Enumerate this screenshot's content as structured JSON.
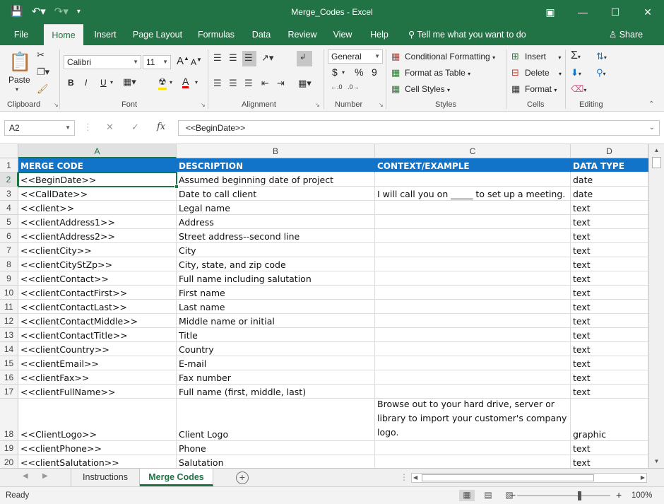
{
  "window": {
    "title": "Merge_Codes  -  Excel",
    "qat_icons": [
      "save-icon",
      "undo-icon",
      "redo-icon",
      "customize-icon"
    ],
    "controls": [
      "ribbon-display-icon",
      "minimize-icon",
      "maximize-icon",
      "close-icon"
    ]
  },
  "ribbon_tabs": [
    "File",
    "Home",
    "Insert",
    "Page Layout",
    "Formulas",
    "Data",
    "Review",
    "View",
    "Help"
  ],
  "active_tab": "Home",
  "tell_me": "Tell me what you want to do",
  "share": "Share",
  "clipboard": {
    "label": "Clipboard",
    "paste": "Paste"
  },
  "font": {
    "label": "Font",
    "name": "Calibri",
    "size": "11",
    "bold": "B",
    "italic": "I",
    "underline": "U",
    "grow": "A",
    "shrink": "A",
    "font_color": "A"
  },
  "alignment": {
    "label": "Alignment"
  },
  "number": {
    "label": "Number",
    "format": "General",
    "currency": "$",
    "percent": "%",
    "comma": "9"
  },
  "styles": {
    "label": "Styles",
    "conditional": "Conditional Formatting",
    "format_table": "Format as Table",
    "cell_styles": "Cell Styles"
  },
  "cells": {
    "label": "Cells",
    "insert": "Insert",
    "delete": "Delete",
    "format": "Format"
  },
  "editing": {
    "label": "Editing"
  },
  "formula_bar": {
    "name_box": "A2",
    "fx": "fx",
    "value": "<<BeginDate>>"
  },
  "columns": [
    "A",
    "B",
    "C",
    "D"
  ],
  "rows": [
    {
      "num": "1",
      "a": "MERGE CODE",
      "b": "DESCRIPTION",
      "c": "CONTEXT/EXAMPLE",
      "d": "DATA TYPE"
    },
    {
      "num": "2",
      "a": "<<BeginDate>>",
      "b": "Assumed beginning date of project",
      "c": "",
      "d": "date"
    },
    {
      "num": "3",
      "a": "<<CallDate>>",
      "b": "Date to call client",
      "c": "I will call you on _____ to set up a meeting.",
      "d": "date"
    },
    {
      "num": "4",
      "a": "<<client>>",
      "b": "Legal name",
      "c": "",
      "d": "text"
    },
    {
      "num": "5",
      "a": "<<clientAddress1>>",
      "b": "Address",
      "c": "",
      "d": "text"
    },
    {
      "num": "6",
      "a": "<<clientAddress2>>",
      "b": "Street address--second line",
      "c": "",
      "d": "text"
    },
    {
      "num": "7",
      "a": "<<clientCity>>",
      "b": "City",
      "c": "",
      "d": "text"
    },
    {
      "num": "8",
      "a": "<<clientCityStZp>>",
      "b": "City, state, and zip code",
      "c": "",
      "d": "text"
    },
    {
      "num": "9",
      "a": "<<clientContact>>",
      "b": "Full name including salutation",
      "c": "",
      "d": "text"
    },
    {
      "num": "10",
      "a": "<<clientContactFirst>>",
      "b": "First name",
      "c": "",
      "d": "text"
    },
    {
      "num": "11",
      "a": "<<clientContactLast>>",
      "b": "Last name",
      "c": "",
      "d": "text"
    },
    {
      "num": "12",
      "a": "<<clientContactMiddle>>",
      "b": "Middle name or initial",
      "c": "",
      "d": "text"
    },
    {
      "num": "13",
      "a": "<<clientContactTitle>>",
      "b": "Title",
      "c": "",
      "d": "text"
    },
    {
      "num": "14",
      "a": "<<clientCountry>>",
      "b": "Country",
      "c": "",
      "d": "text"
    },
    {
      "num": "15",
      "a": "<<clientEmail>>",
      "b": "E-mail",
      "c": "",
      "d": "text"
    },
    {
      "num": "16",
      "a": "<<clientFax>>",
      "b": "Fax number",
      "c": "",
      "d": "text"
    },
    {
      "num": "17",
      "a": "<<clientFullName>>",
      "b": "Full name  (first, middle, last)",
      "c": "",
      "d": "text"
    },
    {
      "num": "18",
      "a": "<<ClientLogo>>",
      "b": "Client Logo",
      "c": "Browse out to your hard drive, server or library to import your customer's company logo.",
      "d": "graphic"
    },
    {
      "num": "19",
      "a": "<<clientPhone>>",
      "b": "Phone",
      "c": "",
      "d": "text"
    },
    {
      "num": "20",
      "a": "<<clientSalutation>>",
      "b": "Salutation",
      "c": "",
      "d": "text"
    }
  ],
  "sheets": [
    "Instructions",
    "Merge Codes"
  ],
  "active_sheet": "Merge Codes",
  "status": {
    "ready": "Ready",
    "zoom": "100%",
    "zoom_minus": "−",
    "zoom_plus": "+"
  },
  "colors": {
    "excel_green": "#217346",
    "header_blue": "#1274c9"
  }
}
